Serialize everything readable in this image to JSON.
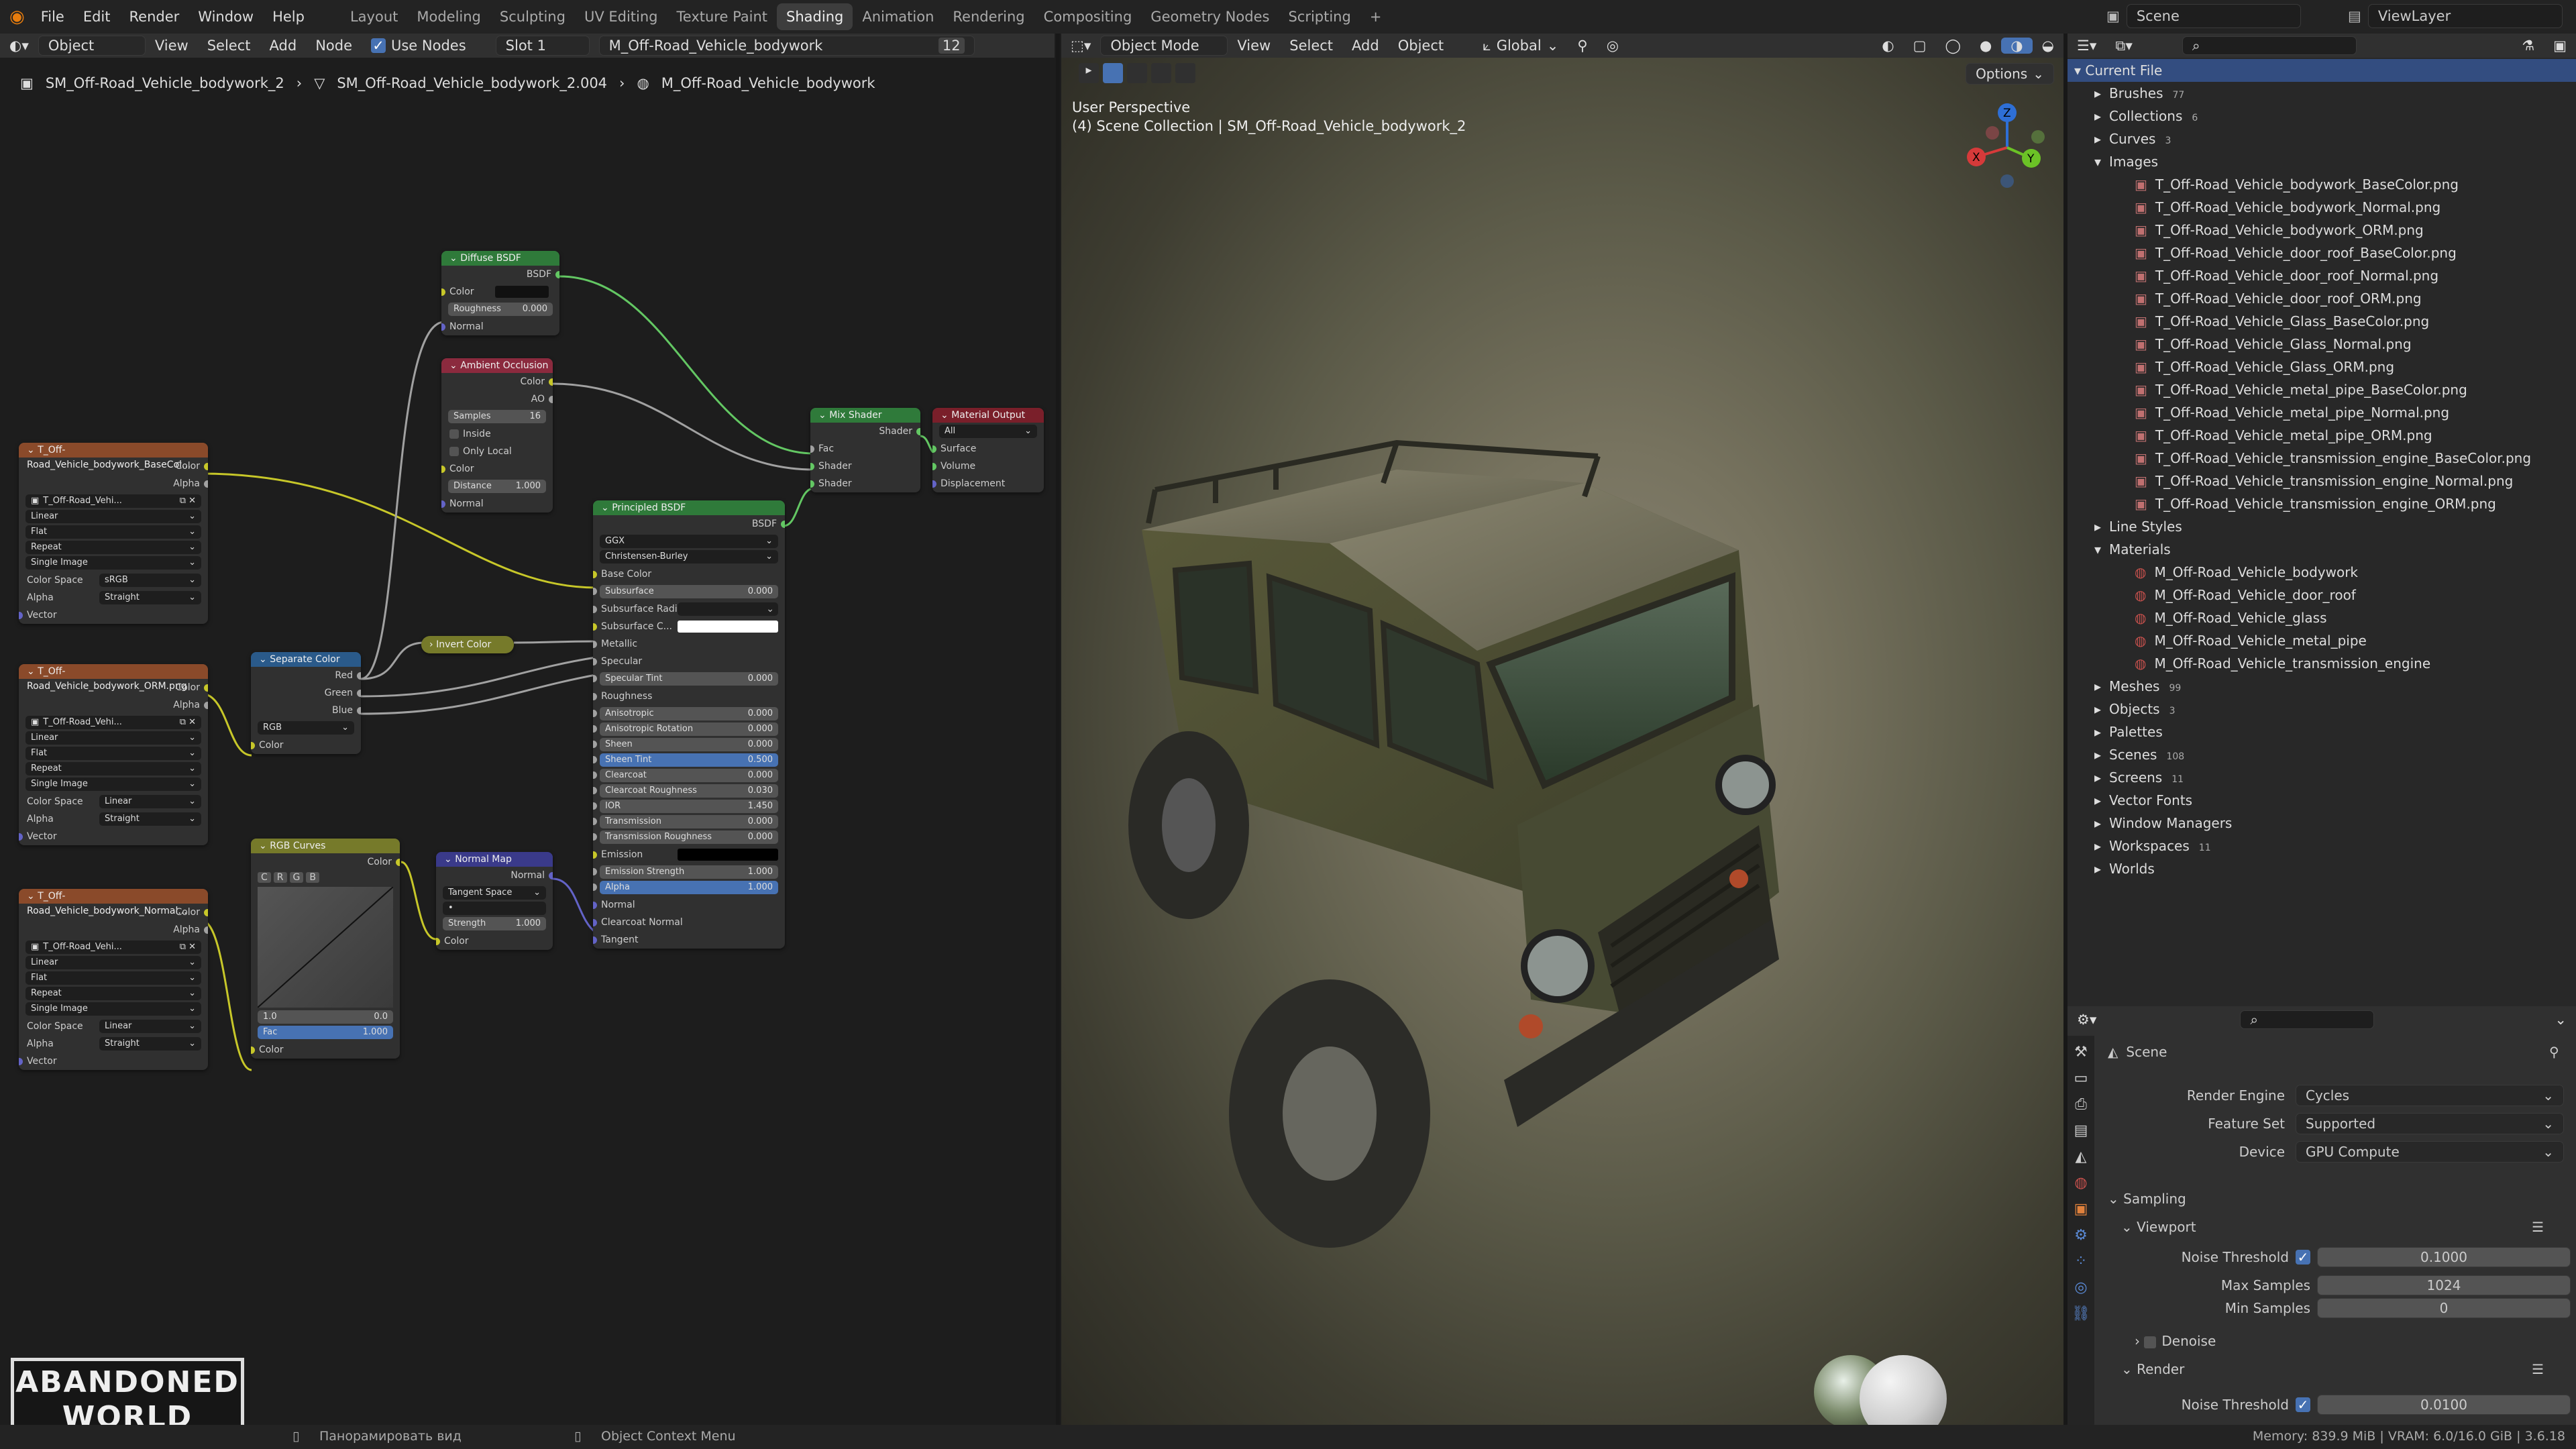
{
  "app": {
    "menus": [
      "File",
      "Edit",
      "Render",
      "Window",
      "Help"
    ],
    "workspaces": [
      "Layout",
      "Modeling",
      "Sculpting",
      "UV Editing",
      "Texture Paint",
      "Shading",
      "Animation",
      "Rendering",
      "Compositing",
      "Geometry Nodes",
      "Scripting"
    ],
    "active_workspace": "Shading",
    "scene": "Scene",
    "view_layer": "ViewLayer"
  },
  "node_editor": {
    "header": {
      "mode": "Object",
      "view": "View",
      "select": "Select",
      "add": "Add",
      "node": "Node",
      "use_nodes": "Use Nodes",
      "slot": "Slot 1",
      "material": "M_Off-Road_Vehicle_bodywork",
      "users": "12"
    },
    "breadcrumb": [
      "SM_Off-Road_Vehicle_bodywork_2",
      "SM_Off-Road_Vehicle_bodywork_2.004",
      "M_Off-Road_Vehicle_bodywork"
    ],
    "nodes": {
      "diffuse": {
        "title": "Diffuse BSDF",
        "out": "BSDF",
        "color": "Color",
        "roughness": "Roughness",
        "roughness_val": "0.000",
        "normal": "Normal"
      },
      "ao": {
        "title": "Ambient Occlusion",
        "out_color": "Color",
        "out_ao": "AO",
        "samples": "Samples",
        "samples_val": "16",
        "inside": "Inside",
        "only_local": "Only Local",
        "color": "Color",
        "distance": "Distance",
        "distance_val": "1.000",
        "normal": "Normal"
      },
      "mix": {
        "title": "Mix Shader",
        "out": "Shader",
        "fac": "Fac",
        "s1": "Shader",
        "s2": "Shader"
      },
      "output": {
        "title": "Material Output",
        "target": "All",
        "surface": "Surface",
        "volume": "Volume",
        "displacement": "Displacement"
      },
      "principled": {
        "title": "Principled BSDF",
        "out": "BSDF",
        "dist": "GGX",
        "sss_method": "Christensen-Burley",
        "rows": [
          {
            "l": "Base Color"
          },
          {
            "l": "Subsurface",
            "v": "0.000"
          },
          {
            "l": "Subsurface Radius",
            "d": true
          },
          {
            "l": "Subsurface C...",
            "c": true
          },
          {
            "l": "Metallic"
          },
          {
            "l": "Specular"
          },
          {
            "l": "Specular Tint",
            "v": "0.000"
          },
          {
            "l": "Roughness"
          },
          {
            "l": "Anisotropic",
            "v": "0.000"
          },
          {
            "l": "Anisotropic Rotation",
            "v": "0.000"
          },
          {
            "l": "Sheen",
            "v": "0.000"
          },
          {
            "l": "Sheen Tint",
            "v": "0.500",
            "b": true
          },
          {
            "l": "Clearcoat",
            "v": "0.000"
          },
          {
            "l": "Clearcoat Roughness",
            "v": "0.030"
          },
          {
            "l": "IOR",
            "v": "1.450"
          },
          {
            "l": "Transmission",
            "v": "0.000"
          },
          {
            "l": "Transmission Roughness",
            "v": "0.000"
          },
          {
            "l": "Emission",
            "k": true
          },
          {
            "l": "Emission Strength",
            "v": "1.000"
          },
          {
            "l": "Alpha",
            "v": "1.000",
            "b": true
          },
          {
            "l": "Normal"
          },
          {
            "l": "Clearcoat Normal"
          },
          {
            "l": "Tangent"
          }
        ]
      },
      "sepcolor": {
        "title": "Separate Color",
        "red": "Red",
        "green": "Green",
        "blue": "Blue",
        "mode": "RGB",
        "color": "Color"
      },
      "invert": {
        "title": "Invert Color"
      },
      "curves": {
        "title": "RGB Curves",
        "out": "Color",
        "chans": [
          "C",
          "R",
          "G",
          "B"
        ],
        "v1": "1.0",
        "v2": "0.0",
        "fac": "Fac",
        "fac_val": "1.000",
        "color": "Color"
      },
      "normalmap": {
        "title": "Normal Map",
        "out": "Normal",
        "space": "Tangent Space",
        "strength": "Strength",
        "strength_val": "1.000",
        "color": "Color"
      },
      "tex1": {
        "title": "T_Off-Road_Vehicle_bodywork_BaseCol...",
        "img": "T_Off-Road_Vehi...",
        "interp": "Linear",
        "proj": "Flat",
        "ext": "Repeat",
        "src": "Single Image",
        "cs": "Color Space",
        "cs_val": "sRGB",
        "alpha": "Alpha",
        "alpha_val": "Straight",
        "vector": "Vector",
        "color": "Color",
        "alpha_out": "Alpha"
      },
      "tex2": {
        "title": "T_Off-Road_Vehicle_bodywork_ORM.png",
        "img": "T_Off-Road_Vehi...",
        "interp": "Linear",
        "proj": "Flat",
        "ext": "Repeat",
        "src": "Single Image",
        "cs": "Color Space",
        "cs_val": "Linear",
        "alpha": "Alpha",
        "alpha_val": "Straight",
        "vector": "Vector",
        "color": "Color",
        "alpha_out": "Alpha"
      },
      "tex3": {
        "title": "T_Off-Road_Vehicle_bodywork_Normal...",
        "img": "T_Off-Road_Vehi...",
        "interp": "Linear",
        "proj": "Flat",
        "ext": "Repeat",
        "src": "Single Image",
        "cs": "Color Space",
        "cs_val": "Linear",
        "alpha": "Alpha",
        "alpha_val": "Straight",
        "vector": "Vector",
        "color": "Color",
        "alpha_out": "Alpha"
      }
    }
  },
  "viewport": {
    "mode": "Object Mode",
    "menus": [
      "View",
      "Select",
      "Add",
      "Object"
    ],
    "orientation": "Global",
    "options": "Options",
    "title": "User Perspective",
    "subtitle": "(4) Scene Collection | SM_Off-Road_Vehicle_bodywork_2",
    "axes": {
      "x": "X",
      "y": "Y",
      "z": "Z"
    }
  },
  "outliner": {
    "root": "Current File",
    "items": [
      {
        "t": "Brushes",
        "e": false,
        "d": 1,
        "c": "77"
      },
      {
        "t": "Collections",
        "e": false,
        "d": 1,
        "c": "6"
      },
      {
        "t": "Curves",
        "e": false,
        "d": 1,
        "c": "3"
      },
      {
        "t": "Images",
        "e": true,
        "d": 1
      },
      {
        "t": "T_Off-Road_Vehicle_bodywork_BaseColor.png",
        "d": 2
      },
      {
        "t": "T_Off-Road_Vehicle_bodywork_Normal.png",
        "d": 2
      },
      {
        "t": "T_Off-Road_Vehicle_bodywork_ORM.png",
        "d": 2
      },
      {
        "t": "T_Off-Road_Vehicle_door_roof_BaseColor.png",
        "d": 2
      },
      {
        "t": "T_Off-Road_Vehicle_door_roof_Normal.png",
        "d": 2
      },
      {
        "t": "T_Off-Road_Vehicle_door_roof_ORM.png",
        "d": 2
      },
      {
        "t": "T_Off-Road_Vehicle_Glass_BaseColor.png",
        "d": 2
      },
      {
        "t": "T_Off-Road_Vehicle_Glass_Normal.png",
        "d": 2
      },
      {
        "t": "T_Off-Road_Vehicle_Glass_ORM.png",
        "d": 2
      },
      {
        "t": "T_Off-Road_Vehicle_metal_pipe_BaseColor.png",
        "d": 2
      },
      {
        "t": "T_Off-Road_Vehicle_metal_pipe_Normal.png",
        "d": 2
      },
      {
        "t": "T_Off-Road_Vehicle_metal_pipe_ORM.png",
        "d": 2
      },
      {
        "t": "T_Off-Road_Vehicle_transmission_engine_BaseColor.png",
        "d": 2
      },
      {
        "t": "T_Off-Road_Vehicle_transmission_engine_Normal.png",
        "d": 2
      },
      {
        "t": "T_Off-Road_Vehicle_transmission_engine_ORM.png",
        "d": 2
      },
      {
        "t": "Line Styles",
        "e": false,
        "d": 1
      },
      {
        "t": "Materials",
        "e": true,
        "d": 1
      },
      {
        "t": "M_Off-Road_Vehicle_bodywork",
        "d": 2,
        "m": true
      },
      {
        "t": "M_Off-Road_Vehicle_door_roof",
        "d": 2,
        "m": true
      },
      {
        "t": "M_Off-Road_Vehicle_glass",
        "d": 2,
        "m": true
      },
      {
        "t": "M_Off-Road_Vehicle_metal_pipe",
        "d": 2,
        "m": true
      },
      {
        "t": "M_Off-Road_Vehicle_transmission_engine",
        "d": 2,
        "m": true
      },
      {
        "t": "Meshes",
        "e": false,
        "d": 1,
        "c": "99"
      },
      {
        "t": "Objects",
        "e": false,
        "d": 1,
        "c": "3"
      },
      {
        "t": "Palettes",
        "e": false,
        "d": 1
      },
      {
        "t": "Scenes",
        "e": false,
        "d": 1,
        "c": "108"
      },
      {
        "t": "Screens",
        "e": false,
        "d": 1,
        "c": "11"
      },
      {
        "t": "Vector Fonts",
        "e": false,
        "d": 1
      },
      {
        "t": "Window Managers",
        "e": false,
        "d": 1
      },
      {
        "t": "Workspaces",
        "e": false,
        "d": 1,
        "c": "11"
      },
      {
        "t": "Worlds",
        "e": false,
        "d": 1
      }
    ]
  },
  "properties": {
    "context": "Scene",
    "render_engine_label": "Render Engine",
    "render_engine": "Cycles",
    "feature_set_label": "Feature Set",
    "feature_set": "Supported",
    "device_label": "Device",
    "device": "GPU Compute",
    "sampling": "Sampling",
    "viewport": "Viewport",
    "noise_threshold_label": "Noise Threshold",
    "vp_noise": "0.1000",
    "max_samples_label": "Max Samples",
    "vp_max": "1024",
    "min_samples_label": "Min Samples",
    "vp_min": "0",
    "denoise": "Denoise",
    "render": "Render",
    "r_noise": "0.0100"
  },
  "status": {
    "hint1": "Панорамировать вид",
    "hint2": "Object Context Menu",
    "stats": "Memory: 839.9 MiB | VRAM: 6.0/16.0 GiB | 3.6.18"
  },
  "watermark": "ABANDONED WORLD"
}
